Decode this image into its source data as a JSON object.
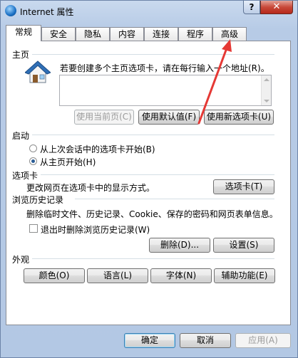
{
  "window": {
    "title": "Internet 属性",
    "help_label": "?",
    "close_label": "✕"
  },
  "tabs": [
    {
      "label": "常规",
      "active": true
    },
    {
      "label": "安全"
    },
    {
      "label": "隐私"
    },
    {
      "label": "内容"
    },
    {
      "label": "连接"
    },
    {
      "label": "程序"
    },
    {
      "label": "高级"
    }
  ],
  "homepage": {
    "section_label": "主页",
    "description": "若要创建多个主页选项卡，请在每行输入一个地址(R)。",
    "url_value": "",
    "use_current_label": "使用当前页(C)",
    "use_default_label": "使用默认值(F)",
    "use_new_tab_label": "使用新选项卡(U)"
  },
  "startup": {
    "section_label": "启动",
    "option_last_session": "从上次会话中的选项卡开始(B)",
    "option_homepage": "从主页开始(H)"
  },
  "tabs_section": {
    "section_label": "选项卡",
    "description": "更改网页在选项卡中的显示方式。",
    "button_label": "选项卡(T)"
  },
  "history": {
    "section_label": "浏览历史记录",
    "description": "删除临时文件、历史记录、Cookie、保存的密码和网页表单信息。",
    "checkbox_label": "退出时删除浏览历史记录(W)",
    "delete_label": "删除(D)...",
    "settings_label": "设置(S)"
  },
  "appearance": {
    "section_label": "外观",
    "colors_label": "颜色(O)",
    "languages_label": "语言(L)",
    "fonts_label": "字体(N)",
    "accessibility_label": "辅助功能(E)"
  },
  "footer": {
    "ok_label": "确定",
    "cancel_label": "取消",
    "apply_label": "应用(A)"
  },
  "colors": {
    "annotation_arrow": "#e53935",
    "accent": "#2a5c95"
  }
}
